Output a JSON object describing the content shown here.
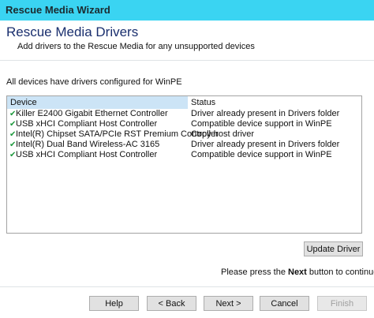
{
  "window": {
    "title": "Rescue Media Wizard"
  },
  "header": {
    "title": "Rescue Media Drivers",
    "subtitle": "Add drivers to the Rescue Media for any unsupported devices"
  },
  "info_text": "All devices have drivers configured for WinPE",
  "device_list": {
    "columns": [
      "Device",
      "Status"
    ],
    "rows": [
      {
        "device": "Killer E2400 Gigabit Ethernet Controller",
        "status": "Driver already present in Drivers folder"
      },
      {
        "device": "USB xHCI Compliant Host Controller",
        "status": "Compatible device support in WinPE"
      },
      {
        "device": "Intel(R) Chipset SATA/PCIe RST Premium Controller",
        "status": "Copy host driver"
      },
      {
        "device": "Intel(R) Dual Band Wireless-AC 3165",
        "status": "Driver already present in Drivers folder"
      },
      {
        "device": "USB xHCI Compliant Host Controller",
        "status": "Compatible device support in WinPE"
      }
    ],
    "check_icon": "check-icon",
    "check_color": "#1f9a3e"
  },
  "update_button": "Update Driver",
  "instruction": {
    "prefix": "Please press the ",
    "emphasis": "Next",
    "suffix": " button to continue."
  },
  "buttons": {
    "help": "Help",
    "back": "< Back",
    "next": "Next >",
    "cancel": "Cancel",
    "finish": "Finish"
  },
  "colors": {
    "titlebar": "#3ad4f2",
    "header_title": "#1a2f6e",
    "list_header_highlight": "#cce4f6"
  }
}
